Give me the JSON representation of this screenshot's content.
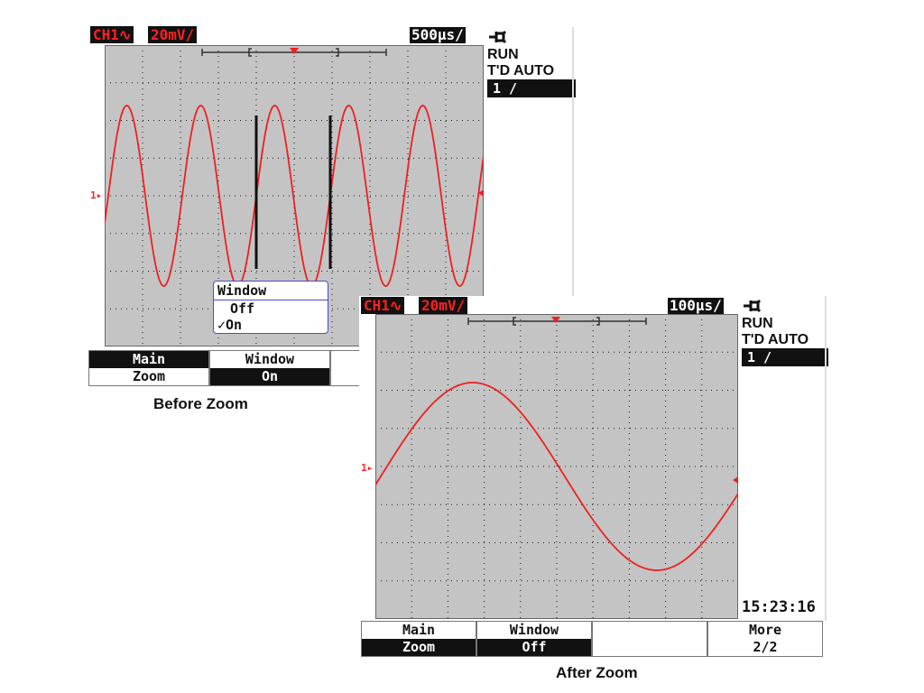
{
  "before": {
    "channel_label": "CH1∿",
    "scale_label": "20mV/",
    "timebase_label": "500µs/",
    "status": "RUN",
    "trigger_mode": "T'D AUTO",
    "trigger_source": "1 /",
    "channel_marker": "1▸",
    "popup": {
      "title": "Window",
      "options": [
        "Off",
        "✓On"
      ]
    },
    "softkeys": [
      {
        "top": "Main",
        "bottom": "Zoom"
      },
      {
        "top": "Window",
        "bottom": "On"
      }
    ],
    "caption": "Before Zoom"
  },
  "after": {
    "channel_label": "CH1∿",
    "scale_label": "20mV/",
    "timebase_label": "100µs/",
    "status": "RUN",
    "trigger_mode": "T'D AUTO",
    "trigger_source": "1 /",
    "channel_marker": "1▸",
    "clock": "15:23:16",
    "softkeys": [
      {
        "top": "Main",
        "bottom": "Zoom"
      },
      {
        "top": "Window",
        "bottom": "Off"
      },
      {
        "top": "",
        "bottom": ""
      },
      {
        "top": "More",
        "bottom": "2/2"
      }
    ],
    "caption": "After Zoom"
  },
  "colors": {
    "trace": "#ee2020",
    "screen_bg": "#c4c4c4",
    "grid": "#1a1a1a",
    "label_bg": "#111111"
  },
  "icons": {
    "trigger_plug": "plug-icon",
    "trigger_position": "trigger-marker-icon"
  }
}
